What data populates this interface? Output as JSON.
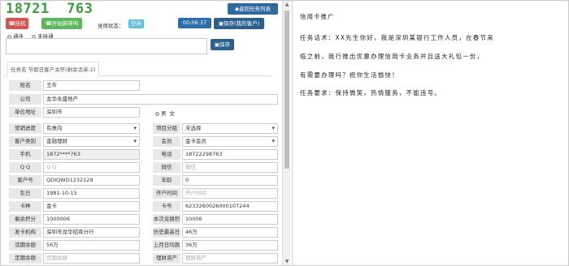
{
  "header": {
    "phone_display": "18721  763",
    "hangup_label": "☎挂机",
    "start_new_call_label": "☎开始新呼叫",
    "seat_status_label": "坐席状态：",
    "seat_status_value": "空闲",
    "timer": "00:06:37",
    "return_task_list_label": "◆返回任务列表",
    "save_my_customer_label": "▣保存(我的客户)"
  },
  "call_result": {
    "options": [
      "通连",
      "未接通"
    ],
    "selected": "通连",
    "remark_value": "",
    "save_label": "▣保存"
  },
  "tab": {
    "label": "任务名 节假日客户关怀(剩余话单:2)"
  },
  "form": {
    "name_label": "姓名",
    "name_value": "王市",
    "company_label": "公司",
    "company_value": "龙华永盛地产",
    "address_label": "单位地址",
    "address_value": "深圳市",
    "gender_label": "男  女",
    "progress_label": "营销进度",
    "progress_value": "有意向",
    "project_group_label": "项目分组",
    "project_group_value": "未选择",
    "customer_type_label": "客户类别",
    "customer_type_value": "金融理财",
    "member_label": "会员",
    "member_value": "金卡会员",
    "mobile_label": "手机",
    "mobile_value": "1872****763",
    "tel_label": "电话",
    "tel_value": "18722298763",
    "qq_label": "Q Q",
    "qq_placeholder": "Q Q",
    "wechat_label": "微信",
    "wechat_placeholder": "微信",
    "customer_no_label": "客户号",
    "customer_no_value": "QDIQWD1232129",
    "age_label": "年龄",
    "age_value": "0",
    "birthday_label": "生日",
    "birthday_value": "1981-10-15",
    "open_time_label": "开户时间",
    "open_time_placeholder": "开户时间",
    "card_type_label": "卡种",
    "card_type_value": "金卡",
    "card_no_label": "卡号",
    "card_no_value": "6233260026000107244",
    "points_label": "剩余积分",
    "points_value": "1000006",
    "exchange_points_label": "本次兑换积",
    "exchange_points_value": "10006",
    "issuing_org_label": "发卡机构",
    "issuing_org_value": "深圳市龙华招商分行",
    "hist_avg_label": "历史最高日",
    "hist_avg_value": "46万",
    "demand_balance_label": "活期余额",
    "demand_balance_value": "56万",
    "last_month_label": "上月日均款",
    "last_month_value": "36万",
    "fixed_balance_label": "定期余额",
    "fixed_balance_placeholder": "定期余额",
    "wealth_label": "理财资产",
    "wealth_placeholder": "理财资产"
  },
  "script_card": {
    "title": "信用卡推广",
    "lines": [
      "任务话术：XX先生你好，我是深圳某银行工作人员，在春节来",
      "临之前，我行推出优惠办理信用卡业务并且送大礼包一份，",
      "有需要办理吗？祝你生活愉快！",
      "任务要求：保持微笑，热情服务，不能违号。"
    ]
  }
}
